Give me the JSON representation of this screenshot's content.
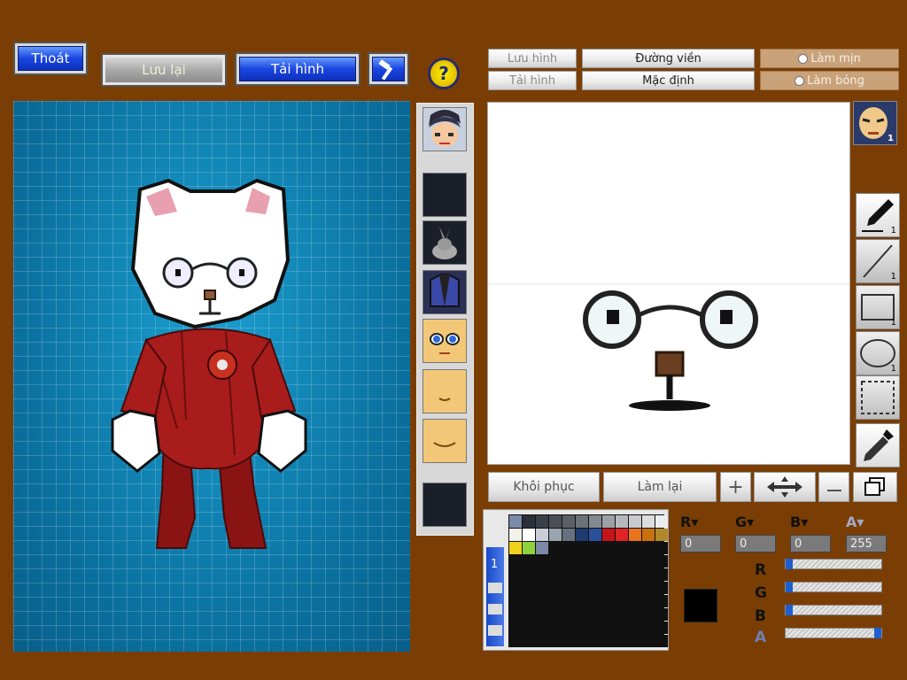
{
  "topbar": {
    "exit_label": "Thoát",
    "save_label": "Lưu lại",
    "load_label": "Tải hình",
    "help_glyph": "?"
  },
  "right_tabs": {
    "save_image": "Lưu hình",
    "load_image": "Tải hình",
    "outline": "Đường viền",
    "default": "Mặc định",
    "smooth": "Làm mịn",
    "shine": "Làm bóng"
  },
  "part_badge_count": "1",
  "tools": [
    {
      "name": "pen-tool",
      "count": "1"
    },
    {
      "name": "line-tool",
      "count": "1"
    },
    {
      "name": "rectangle-tool",
      "count": "1"
    },
    {
      "name": "ellipse-tool",
      "count": "1"
    },
    {
      "name": "selection-tool",
      "count": ""
    },
    {
      "name": "eyedropper-tool",
      "count": ""
    }
  ],
  "lower_buttons": {
    "restore": "Khôi phục",
    "redo": "Làm lại",
    "plus": "+"
  },
  "palette_tab": "1",
  "palette_colors": [
    "#7a8aa8",
    "#2a2f3a",
    "#3b3f48",
    "#4a4e56",
    "#5b5f66",
    "#6e7278",
    "#858990",
    "#9da1a7",
    "#b5b8bd",
    "#c8cacd",
    "#dcdde0",
    "#ecedee",
    "#f2f2ea",
    "#ffffff",
    "#c9ced6",
    "#9aa3b0",
    "#66707e",
    "#1f3a6e",
    "#2b4f9a",
    "#c4141a",
    "#e02424",
    "#e8731a",
    "#c8700e",
    "#b08828",
    "#f0d21a",
    "#8dd23c",
    "#7c8aa8",
    "#111111",
    "#111111",
    "#111111",
    "#111111",
    "#111111",
    "#111111",
    "#111111",
    "#111111",
    "#111111"
  ],
  "color": {
    "r_label": "R",
    "g_label": "G",
    "b_label": "B",
    "a_label": "A",
    "r": "0",
    "g": "0",
    "b": "0",
    "a": "255",
    "r_level": 0,
    "g_level": 0,
    "b_level": 0,
    "a_level": 1,
    "current_color": "#000000"
  },
  "colors": {
    "background": "#7a3e05",
    "accent_blue": "#1a45e0",
    "preview_bg": "#0b7fb0"
  }
}
